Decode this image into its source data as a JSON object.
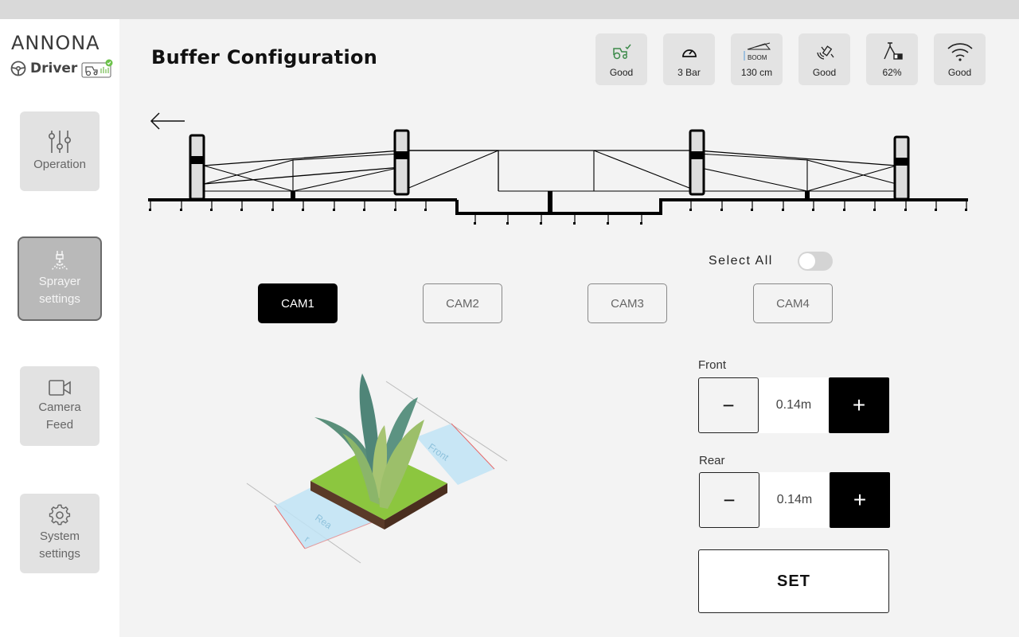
{
  "app": {
    "brand": "ANNONA",
    "brand_sub": "Driver"
  },
  "sidebar": {
    "items": [
      {
        "label_1": "Operation",
        "icon": "sliders-icon"
      },
      {
        "label_1": "Sprayer",
        "label_2": "settings",
        "icon": "sprayer-icon",
        "active": true
      },
      {
        "label_1": "Camera",
        "label_2": "Feed",
        "icon": "video-camera-icon"
      },
      {
        "label_1": "System",
        "label_2": "settings",
        "icon": "gear-icon"
      }
    ]
  },
  "header": {
    "title": "Buffer Configuration",
    "status": [
      {
        "icon": "tractor-icon",
        "value": "Good"
      },
      {
        "icon": "pressure-gauge-icon",
        "value": "3 Bar"
      },
      {
        "icon": "boom-height-icon",
        "icon_text": "BOOM",
        "value": "130 cm"
      },
      {
        "icon": "gps-satellite-icon",
        "value": "Good"
      },
      {
        "icon": "tank-level-icon",
        "value": "62%"
      },
      {
        "icon": "wifi-icon",
        "value": "Good"
      }
    ]
  },
  "controls": {
    "select_all_label": "Select All",
    "select_all_on": false,
    "cameras": [
      {
        "label": "CAM1",
        "active": true
      },
      {
        "label": "CAM2",
        "active": false
      },
      {
        "label": "CAM3",
        "active": false
      },
      {
        "label": "CAM4",
        "active": false
      }
    ]
  },
  "illustration": {
    "front_zone_label": "Front",
    "rear_zone_label_1": "Rea",
    "rear_zone_label_2": "r"
  },
  "buffer": {
    "front_label": "Front",
    "front_value": "0.14m",
    "rear_label": "Rear",
    "rear_value": "0.14m",
    "minus_symbol": "−",
    "plus_symbol": "+",
    "set_label": "SET"
  },
  "colors": {
    "accent": "#000000",
    "sidebar_active": "#b9b9b9",
    "plant_green": "#8cc63f",
    "buffer_zone_blue": "#bfe3f5",
    "buffer_edge_red": "#e86a6a"
  }
}
